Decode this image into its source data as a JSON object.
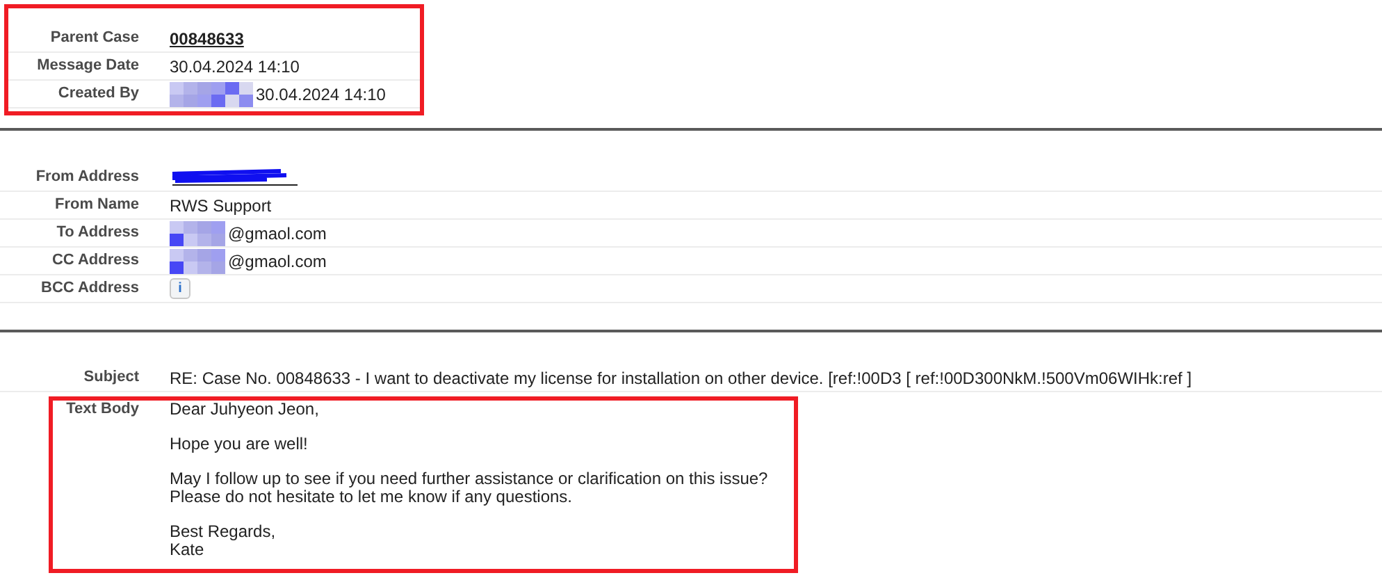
{
  "sections": [
    {
      "highlighted": true,
      "fields": [
        {
          "label": "Parent Case",
          "kind": "link",
          "value": "00848633"
        },
        {
          "label": "Message Date",
          "kind": "text",
          "value": "30.04.2024 14:10"
        },
        {
          "label": "Created By",
          "kind": "redacted",
          "value": "30.04.2024 14:10"
        }
      ]
    },
    {
      "fields": [
        {
          "label": "From Address",
          "kind": "scribble"
        },
        {
          "label": "From Name",
          "kind": "text",
          "value": "RWS Support"
        },
        {
          "label": "To Address",
          "kind": "redacted",
          "value": "@gmaol.com"
        },
        {
          "label": "CC Address",
          "kind": "redacted",
          "value": "@gmaol.com"
        },
        {
          "label": "BCC Address",
          "kind": "info",
          "value": "i"
        }
      ]
    },
    {
      "fields": [
        {
          "label": "Subject",
          "kind": "text",
          "value": "RE: Case No. 00848633 - I want to deactivate my license for installation on other device. [ref:!00D3 [ ref:!00D300NkM.!500Vm06WIHk:ref ]"
        }
      ]
    }
  ],
  "text_body": {
    "label": "Text Body",
    "highlighted": true,
    "paragraphs": [
      "Dear Juhyeon Jeon,",
      "Hope you are well!",
      "May I follow up to see if you need further assistance or clarification on this issue?\nPlease do not hesitate to let me know if any questions.",
      "Best Regards,\nKate"
    ]
  }
}
